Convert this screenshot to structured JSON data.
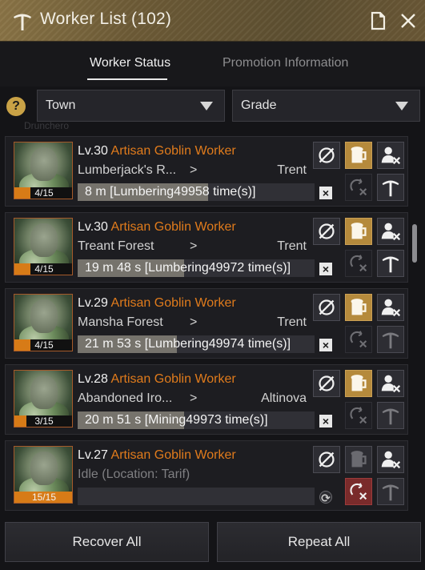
{
  "window": {
    "title": "Worker List (102)",
    "title_icon": "pickaxe-icon",
    "doc_icon": "document-icon",
    "close_icon": "close-icon"
  },
  "tabs": [
    {
      "label": "Worker Status",
      "active": true
    },
    {
      "label": "Promotion Information",
      "active": false
    }
  ],
  "filters": {
    "help_label": "?",
    "town": "Town",
    "grade": "Grade"
  },
  "background_text": "Drunchero",
  "workers": [
    {
      "level": "Lv.30",
      "name": "Artisan Goblin Worker",
      "location": "Lumberjack's R...",
      "arrow": ">",
      "destination": "Trent",
      "stamina": "4/15",
      "stamina_fraction": 0.267,
      "job": "8 m [Lumbering49958 time(s)]",
      "job_progress": 0.55,
      "beer_active": true,
      "repeat_active": false,
      "idle": false
    },
    {
      "level": "Lv.30",
      "name": "Artisan Goblin Worker",
      "location": "Treant Forest",
      "arrow": ">",
      "destination": "Trent",
      "stamina": "4/15",
      "stamina_fraction": 0.267,
      "job": "19 m 48 s [Lumbering49972 time(s)]",
      "job_progress": 0.45,
      "beer_active": true,
      "repeat_active": false,
      "idle": false
    },
    {
      "level": "Lv.29",
      "name": "Artisan Goblin Worker",
      "location": "Mansha Forest",
      "arrow": ">",
      "destination": "Trent",
      "stamina": "4/15",
      "stamina_fraction": 0.267,
      "job": "21 m 53 s [Lumbering49974 time(s)]",
      "job_progress": 0.42,
      "beer_active": true,
      "repeat_active": false,
      "idle": false
    },
    {
      "level": "Lv.28",
      "name": "Artisan Goblin Worker",
      "location": "Abandoned Iro...",
      "arrow": ">",
      "destination": "Altinova",
      "stamina": "3/15",
      "stamina_fraction": 0.2,
      "job": "20 m 51 s [Mining49973 time(s)]",
      "job_progress": 0.45,
      "beer_active": true,
      "repeat_active": false,
      "idle": false
    },
    {
      "level": "Lv.27",
      "name": "Artisan Goblin Worker",
      "location": "Idle (Location: Tarif)",
      "arrow": "",
      "destination": "",
      "stamina": "15/15",
      "stamina_fraction": 1.0,
      "job": "",
      "job_progress": 0,
      "beer_active": false,
      "repeat_active": true,
      "idle": true
    }
  ],
  "icons": {
    "pause": "pause-slash-icon",
    "beer": "beer-mug-icon",
    "fire": "fire-worker-icon",
    "repeat": "repeat-cancel-icon",
    "promote": "promote-pickaxe-icon"
  },
  "footer": {
    "recover_all": "Recover All",
    "repeat_all": "Repeat All"
  },
  "colors": {
    "accent_orange": "#e07b1c",
    "beer_gold": "#b58a3c",
    "repeat_red": "#7a2b2b",
    "titlebar_gold": "#7a6640"
  }
}
